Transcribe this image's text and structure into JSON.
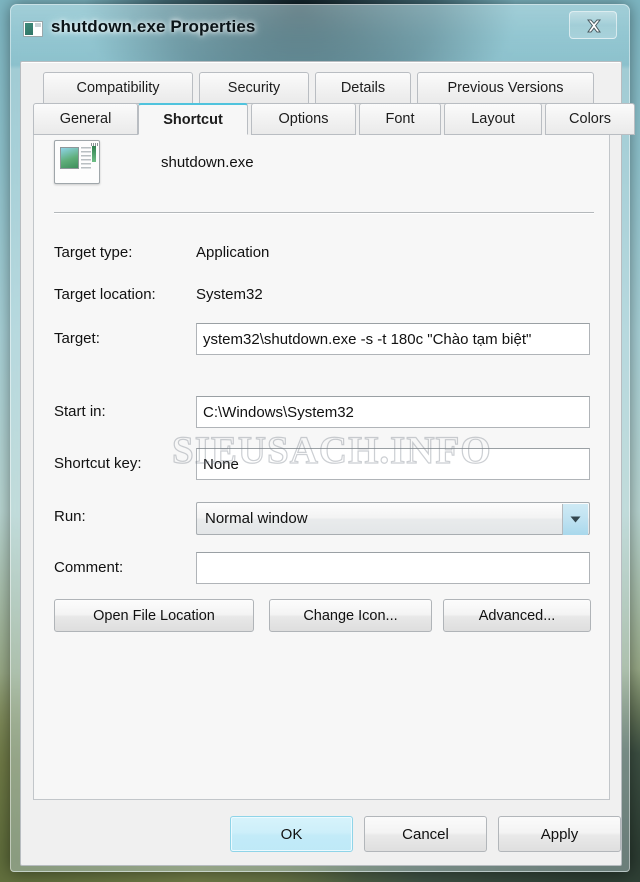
{
  "window": {
    "title": "shutdown.exe Properties",
    "icon": "app-window-icon",
    "close_label": "✕"
  },
  "tabs": {
    "row_top": [
      {
        "label": "Compatibility",
        "selected": false
      },
      {
        "label": "Security",
        "selected": false
      },
      {
        "label": "Details",
        "selected": false
      },
      {
        "label": "Previous Versions",
        "selected": false
      }
    ],
    "row_bottom": [
      {
        "label": "General",
        "selected": false
      },
      {
        "label": "Shortcut",
        "selected": true
      },
      {
        "label": "Options",
        "selected": false
      },
      {
        "label": "Font",
        "selected": false
      },
      {
        "label": "Layout",
        "selected": false
      },
      {
        "label": "Colors",
        "selected": false
      }
    ]
  },
  "shortcut": {
    "file_name": "shutdown.exe",
    "target_type_label": "Target type:",
    "target_type_value": "Application",
    "target_location_label": "Target location:",
    "target_location_value": "System32",
    "target_label": "Target:",
    "target_value": "ystem32\\shutdown.exe -s -t 180c \"Chào tạm biệt\"",
    "start_in_label": "Start in:",
    "start_in_value": "C:\\Windows\\System32",
    "shortcut_key_label": "Shortcut key:",
    "shortcut_key_value": "None",
    "run_label": "Run:",
    "run_value": "Normal window",
    "comment_label": "Comment:",
    "comment_value": "",
    "buttons": {
      "open_file_location": "Open File Location",
      "change_icon": "Change Icon...",
      "advanced": "Advanced..."
    }
  },
  "footer": {
    "ok": "OK",
    "cancel": "Cancel",
    "apply": "Apply"
  },
  "watermark": {
    "text": "SIEUSACH.INFO"
  },
  "colors": {
    "accent": "#4fc3dd",
    "default_button": "#c2ebf8",
    "dialog_bg": "#f0f0f0",
    "panel_bg": "#f7f7f7"
  }
}
